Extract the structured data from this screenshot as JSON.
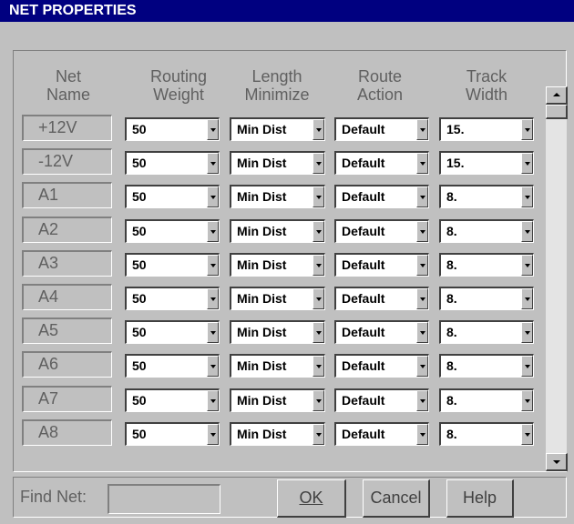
{
  "window": {
    "title": "NET PROPERTIES"
  },
  "headers": {
    "net_name": [
      "Net",
      "Name"
    ],
    "routing_weight": [
      "Routing",
      "Weight"
    ],
    "length_minimize": [
      "Length",
      "Minimize"
    ],
    "route_action": [
      "Route",
      "Action"
    ],
    "track_width": [
      "Track",
      "Width"
    ]
  },
  "rows": [
    {
      "net": "+12V",
      "weight": "50",
      "length": "Min Dist",
      "action": "Default",
      "width": "15."
    },
    {
      "net": "-12V",
      "weight": "50",
      "length": "Min Dist",
      "action": "Default",
      "width": "15."
    },
    {
      "net": "A1",
      "weight": "50",
      "length": "Min Dist",
      "action": "Default",
      "width": "8."
    },
    {
      "net": "A2",
      "weight": "50",
      "length": "Min Dist",
      "action": "Default",
      "width": "8."
    },
    {
      "net": "A3",
      "weight": "50",
      "length": "Min Dist",
      "action": "Default",
      "width": "8."
    },
    {
      "net": "A4",
      "weight": "50",
      "length": "Min Dist",
      "action": "Default",
      "width": "8."
    },
    {
      "net": "A5",
      "weight": "50",
      "length": "Min Dist",
      "action": "Default",
      "width": "8."
    },
    {
      "net": "A6",
      "weight": "50",
      "length": "Min Dist",
      "action": "Default",
      "width": "8."
    },
    {
      "net": "A7",
      "weight": "50",
      "length": "Min Dist",
      "action": "Default",
      "width": "8."
    },
    {
      "net": "A8",
      "weight": "50",
      "length": "Min Dist",
      "action": "Default",
      "width": "8."
    }
  ],
  "footer": {
    "find_label": "Find Net:",
    "find_value": "",
    "ok_label": "OK",
    "cancel_label": "Cancel",
    "help_label": "Help"
  },
  "colors": {
    "title_bg": "#000080",
    "face": "#c0c0c0"
  }
}
